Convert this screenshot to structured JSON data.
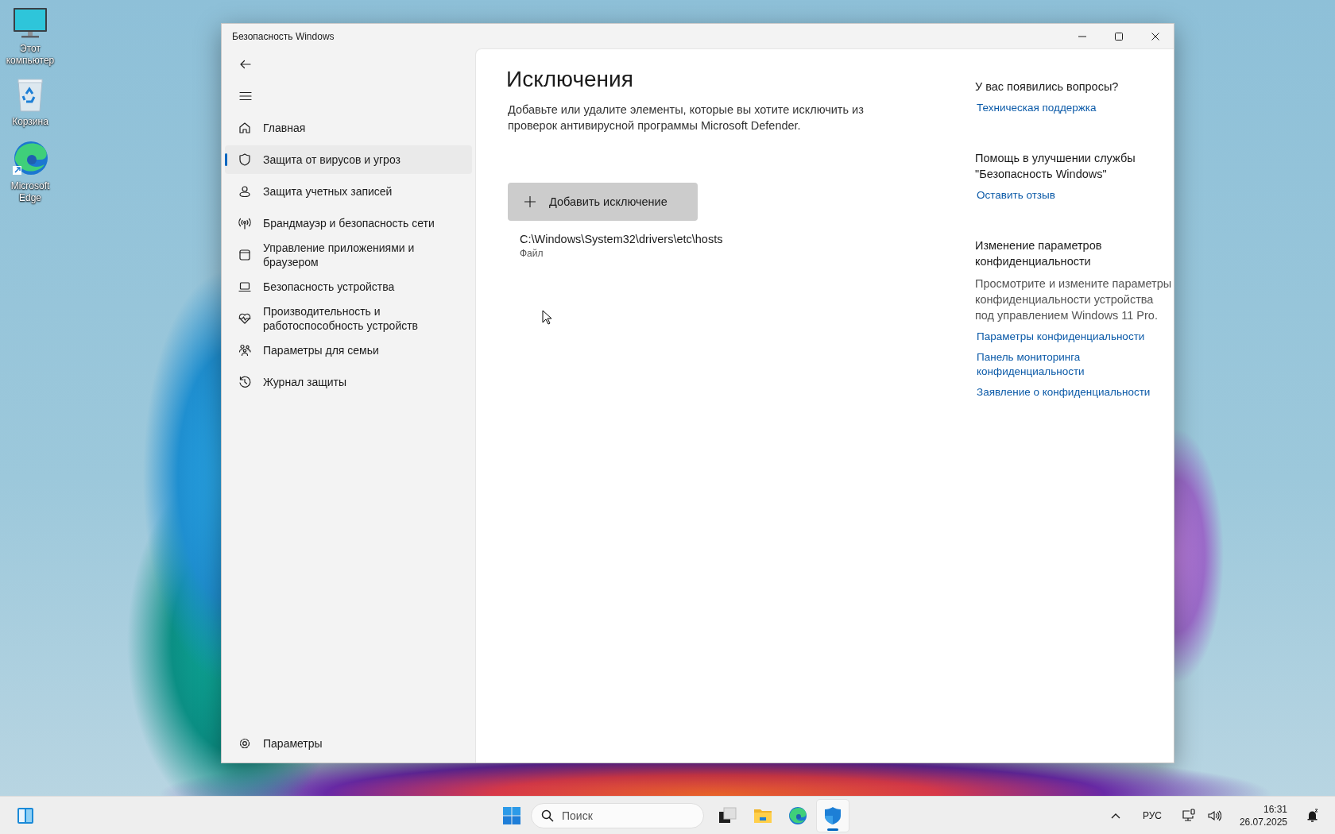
{
  "desktop_icons": [
    {
      "kind": "monitor",
      "label": "Этот компьютер"
    },
    {
      "kind": "bin",
      "label": "Корзина"
    },
    {
      "kind": "edge",
      "label": "Microsoft Edge"
    }
  ],
  "window": {
    "title": "Безопасность Windows"
  },
  "sidebar": {
    "items": [
      {
        "kind": "home",
        "label": "Главная",
        "selected": false
      },
      {
        "kind": "shield",
        "label": "Защита от вирусов и угроз",
        "selected": true
      },
      {
        "kind": "person",
        "label": "Защита учетных записей",
        "selected": false
      },
      {
        "kind": "antenna",
        "label": "Брандмауэр и безопасность сети",
        "selected": false
      },
      {
        "kind": "window",
        "label": "Управление приложениями и браузером",
        "selected": false
      },
      {
        "kind": "laptop",
        "label": "Безопасность устройства",
        "selected": false
      },
      {
        "kind": "heart",
        "label": "Производительность и работоспособность устройств",
        "selected": false
      },
      {
        "kind": "family",
        "label": "Параметры для семьи",
        "selected": false
      },
      {
        "kind": "history",
        "label": "Журнал защиты",
        "selected": false
      }
    ],
    "footer": {
      "label": "Параметры"
    }
  },
  "page": {
    "title": "Исключения",
    "description": "Добавьте или удалите элементы, которые вы хотите исключить из проверок антивирусной программы Microsoft Defender.",
    "add_button": "Добавить исключение",
    "exclusions": [
      {
        "path": "C:\\Windows\\System32\\drivers\\etc\\hosts",
        "type": "Файл"
      }
    ]
  },
  "aside": {
    "sections": [
      {
        "heading": "У вас появились вопросы?",
        "links": [
          "Техническая поддержка"
        ]
      },
      {
        "heading": "Помощь в улучшении службы \"Безопасность Windows\"",
        "links": [
          "Оставить отзыв"
        ]
      },
      {
        "heading": "Изменение параметров конфиденциальности",
        "text": "Просмотрите и измените параметры конфиденциальности устройства под управлением Windows 11 Pro.",
        "links": [
          "Параметры конфиденциальности",
          "Панель мониторинга конфиденциальности",
          "Заявление о конфиденциальности"
        ]
      }
    ]
  },
  "taskbar": {
    "search_placeholder": "Поиск",
    "apps": [
      {
        "kind": "taskview",
        "active": false
      },
      {
        "kind": "explorer",
        "active": false
      },
      {
        "kind": "edge",
        "active": false
      },
      {
        "kind": "security",
        "active": true
      }
    ],
    "language": "РУС",
    "time": "16:31",
    "date": "26.07.2025"
  }
}
